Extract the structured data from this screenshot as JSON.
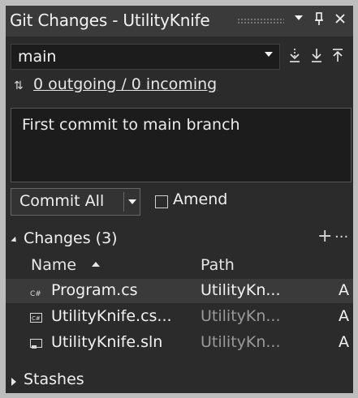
{
  "window": {
    "title": "Git Changes - UtilityKnife",
    "icons": [
      "dropdown-icon",
      "pin-icon",
      "close-icon"
    ]
  },
  "branch": {
    "name": "main",
    "sync_icons": [
      "fetch-icon",
      "pull-icon",
      "push-icon"
    ]
  },
  "sync": {
    "status": "0 outgoing / 0 incoming"
  },
  "commit": {
    "message": "First commit to main branch",
    "button_label": "Commit All",
    "amend_label": "Amend",
    "amend_checked": false
  },
  "changes": {
    "header": "Changes (3)",
    "columns": {
      "name": "Name",
      "path": "Path"
    },
    "rows": [
      {
        "name": "Program.cs",
        "path": "UtilityKn...",
        "status": "A",
        "icon": "csharp-file-icon",
        "selected": true
      },
      {
        "name": "UtilityKnife.cs...",
        "path": "UtilityKn...",
        "status": "A",
        "icon": "csharp-project-icon",
        "selected": false
      },
      {
        "name": "UtilityKnife.sln",
        "path": "UtilityKn...",
        "status": "A",
        "icon": "solution-file-icon",
        "selected": false
      }
    ]
  },
  "stashes": {
    "header": "Stashes"
  },
  "colors": {
    "panel_bg": "#2b2b2b",
    "titlebar_bg": "#3a3a3a",
    "input_bg": "#1c1c1c",
    "selected_row_bg": "#3a3a3a",
    "text": "#f2f2f2",
    "muted_text": "#9a9a9a"
  }
}
